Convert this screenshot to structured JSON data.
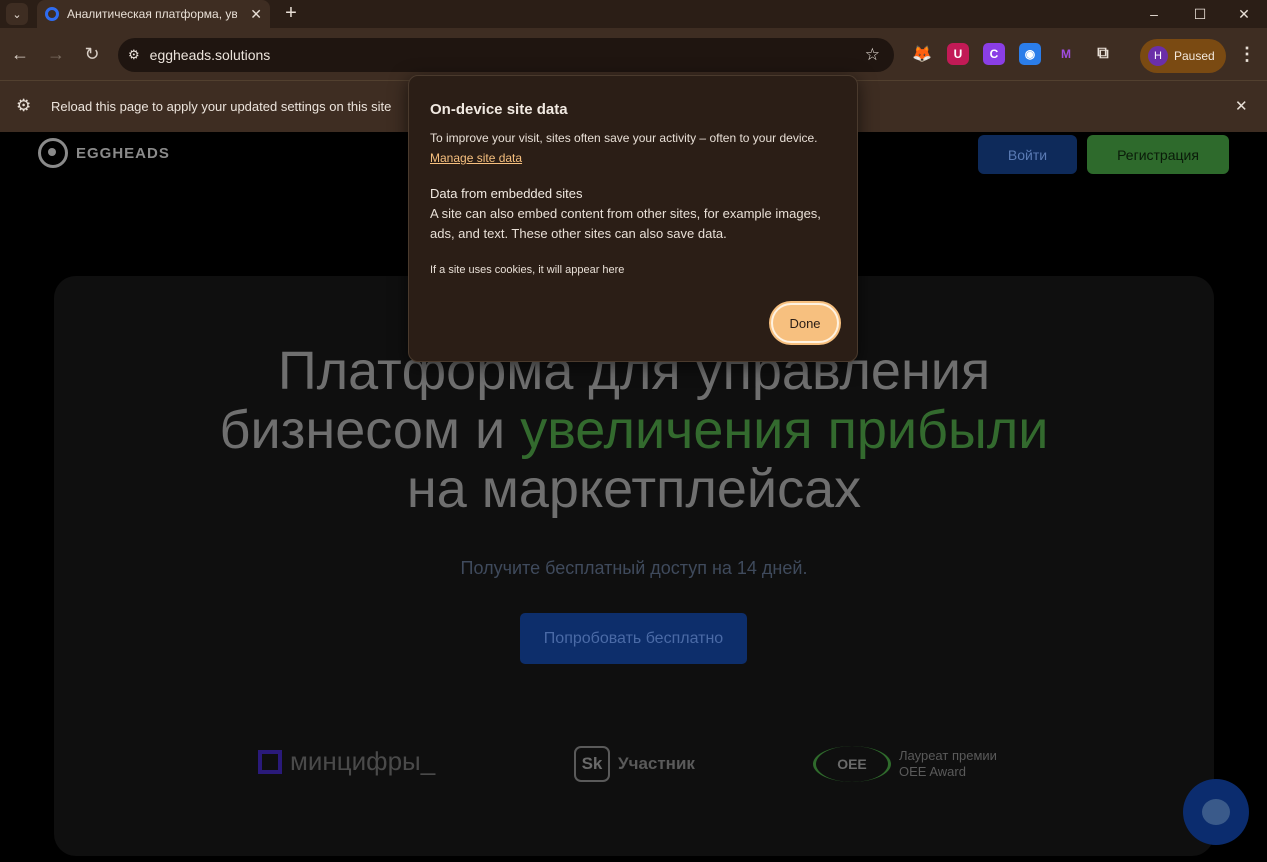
{
  "browser": {
    "tab_title": "Аналитическая платформа, уве",
    "url": "eggheads.solutions",
    "profile_initial": "H",
    "profile_label": "Paused"
  },
  "infobar": {
    "message": "Reload this page to apply your updated settings on this site"
  },
  "site": {
    "logo_text": "EGGHEADS",
    "login_label": "Войти",
    "signup_label": "Регистрация",
    "headline_line1": "Платформа для управления",
    "headline_line2_a": "бизнесом и ",
    "headline_line2_b": "увеличения прибыли",
    "headline_line3": "на маркетплейсах",
    "subtitle": "Получите бесплатный доступ на 14 дней.",
    "cta_label": "Попробовать бесплатно",
    "partner_mincifry": "минцифры_",
    "partner_sk": "Участник",
    "partner_oee_line1": "Лауреат премии",
    "partner_oee_line2": "OEE Award"
  },
  "dialog": {
    "title": "On-device site data",
    "intro": "To improve your visit, sites often save your activity – often to your device.",
    "manage_link": "Manage site data",
    "embedded_heading": "Data from embedded sites",
    "embedded_text": "A site can also embed content from other sites, for example images, ads, and text. These other sites can also save data.",
    "cookies_note": "If a site uses cookies, it will appear here",
    "done_label": "Done"
  },
  "colors": {
    "accent": "#f7c07f",
    "chrome_bg": "#3e2d22",
    "green_text": "#336a2e"
  }
}
